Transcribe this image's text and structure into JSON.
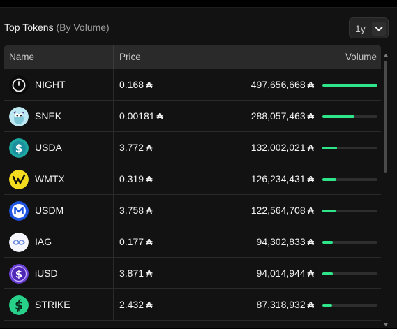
{
  "header": {
    "title": "Top Tokens",
    "subtitle": "(By Volume)",
    "period_value": "1y"
  },
  "columns": {
    "name": "Name",
    "price": "Price",
    "volume": "Volume"
  },
  "currency_symbol": "₳",
  "tokens": [
    {
      "name": "NIGHT",
      "price": "0.168",
      "volume": "497,656,668",
      "volume_share": 1.0,
      "icon": "night-icon"
    },
    {
      "name": "SNEK",
      "price": "0.00181",
      "volume": "288,057,463",
      "volume_share": 0.579,
      "icon": "snek-icon"
    },
    {
      "name": "USDA",
      "price": "3.772",
      "volume": "132,002,021",
      "volume_share": 0.265,
      "icon": "usda-icon"
    },
    {
      "name": "WMTX",
      "price": "0.319",
      "volume": "126,234,431",
      "volume_share": 0.254,
      "icon": "wmtx-icon"
    },
    {
      "name": "USDM",
      "price": "3.758",
      "volume": "122,564,708",
      "volume_share": 0.246,
      "icon": "usdm-icon"
    },
    {
      "name": "IAG",
      "price": "0.177",
      "volume": "94,302,833",
      "volume_share": 0.189,
      "icon": "iag-icon"
    },
    {
      "name": "iUSD",
      "price": "3.871",
      "volume": "94,014,944",
      "volume_share": 0.189,
      "icon": "iusd-icon"
    },
    {
      "name": "STRIKE",
      "price": "2.432",
      "volume": "87,318,932",
      "volume_share": 0.175,
      "icon": "strike-icon"
    }
  ],
  "colors": {
    "accent_bar": "#2ee58a",
    "panel_bg": "#121212",
    "header_bg": "#2a2a2a"
  }
}
